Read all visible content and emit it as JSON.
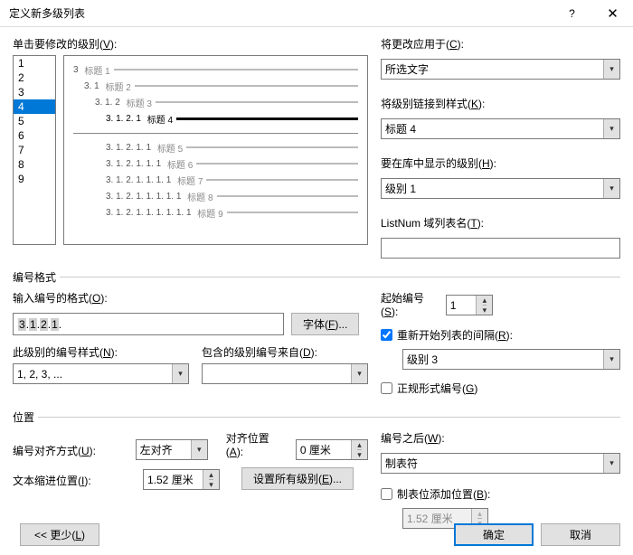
{
  "title": "定义新多级列表",
  "level_label_pre": "单击要修改的级别(",
  "level_label_accel": "V",
  "level_label_post": "):",
  "levels": [
    "1",
    "2",
    "3",
    "4",
    "5",
    "6",
    "7",
    "8",
    "9"
  ],
  "selected_level": "4",
  "preview": [
    {
      "indent": 0,
      "num": "3",
      "title": "标题 1",
      "cur": false
    },
    {
      "indent": 1,
      "num": "3. 1",
      "title": "标题 2",
      "cur": false
    },
    {
      "indent": 2,
      "num": "3. 1. 2",
      "title": "标题 3",
      "cur": false
    },
    {
      "indent": 3,
      "num": "3. 1. 2. 1",
      "title": "标题 4",
      "cur": true
    },
    {
      "divider": true
    },
    {
      "indent": 3,
      "num": "3. 1. 2. 1. 1",
      "title": "标题 5",
      "cur": false
    },
    {
      "indent": 3,
      "num": "3. 1. 2. 1. 1. 1",
      "title": "标题 6",
      "cur": false
    },
    {
      "indent": 3,
      "num": "3. 1. 2. 1. 1. 1. 1",
      "title": "标题 7",
      "cur": false
    },
    {
      "indent": 3,
      "num": "3. 1. 2. 1. 1. 1. 1. 1",
      "title": "标题 8",
      "cur": false
    },
    {
      "indent": 3,
      "num": "3. 1. 2. 1. 1. 1. 1. 1. 1",
      "title": "标题 9",
      "cur": false
    }
  ],
  "right": {
    "apply_to_label_pre": "将更改应用于(",
    "apply_to_accel": "C",
    "apply_to_label_post": "):",
    "apply_to_value": "所选文字",
    "link_style_label_pre": "将级别链接到样式(",
    "link_style_accel": "K",
    "link_style_label_post": "):",
    "link_style_value": "标题 4",
    "show_in_lib_label_pre": "要在库中显示的级别(",
    "show_in_lib_accel": "H",
    "show_in_lib_label_post": "):",
    "show_in_lib_value": "级别 1",
    "listnum_label_pre": "ListNum 域列表名(",
    "listnum_accel": "T",
    "listnum_label_post": "):",
    "listnum_value": ""
  },
  "numfmt": {
    "legend": "编号格式",
    "enter_label_pre": "输入编号的格式(",
    "enter_accel": "O",
    "enter_label_post": "):",
    "segments": [
      "3",
      "1",
      "2",
      "1"
    ],
    "font_btn_pre": "字体(",
    "font_accel": "F",
    "font_btn_post": ")...",
    "style_label_pre": "此级别的编号样式(",
    "style_accel": "N",
    "style_label_post": "):",
    "style_value": "1, 2, 3, ...",
    "include_label_pre": "包含的级别编号来自(",
    "include_accel": "D",
    "include_label_post": "):",
    "include_value": "",
    "start_label_pre": "起始编号(",
    "start_accel": "S",
    "start_label_post": "):",
    "start_value": "1",
    "restart_checked": true,
    "restart_label_pre": "重新开始列表的间隔(",
    "restart_accel": "R",
    "restart_label_post": "):",
    "restart_value": "级别 3",
    "legal_checked": false,
    "legal_label_pre": "正规形式编号(",
    "legal_accel": "G",
    "legal_label_post": ")"
  },
  "pos": {
    "legend": "位置",
    "align_label_pre": "编号对齐方式(",
    "align_accel": "U",
    "align_label_post": "):",
    "align_value": "左对齐",
    "alignpos_label_pre": "对齐位置(",
    "alignpos_accel": "A",
    "alignpos_label_post": "):",
    "alignpos_value": "0 厘米",
    "indent_label_pre": "文本缩进位置(",
    "indent_accel": "I",
    "indent_label_post": "):",
    "indent_value": "1.52 厘米",
    "setall_btn_pre": "设置所有级别(",
    "setall_accel": "E",
    "setall_btn_post": ")...",
    "follow_label_pre": "编号之后(",
    "follow_accel": "W",
    "follow_label_post": "):",
    "follow_value": "制表符",
    "tabstop_checked": false,
    "tabstop_label_pre": "制表位添加位置(",
    "tabstop_accel": "B",
    "tabstop_label_post": "):",
    "tabstop_value": "1.52 厘米"
  },
  "footer": {
    "less_pre": "<< 更少(",
    "less_accel": "L",
    "less_post": ")",
    "ok": "确定",
    "cancel": "取消"
  }
}
